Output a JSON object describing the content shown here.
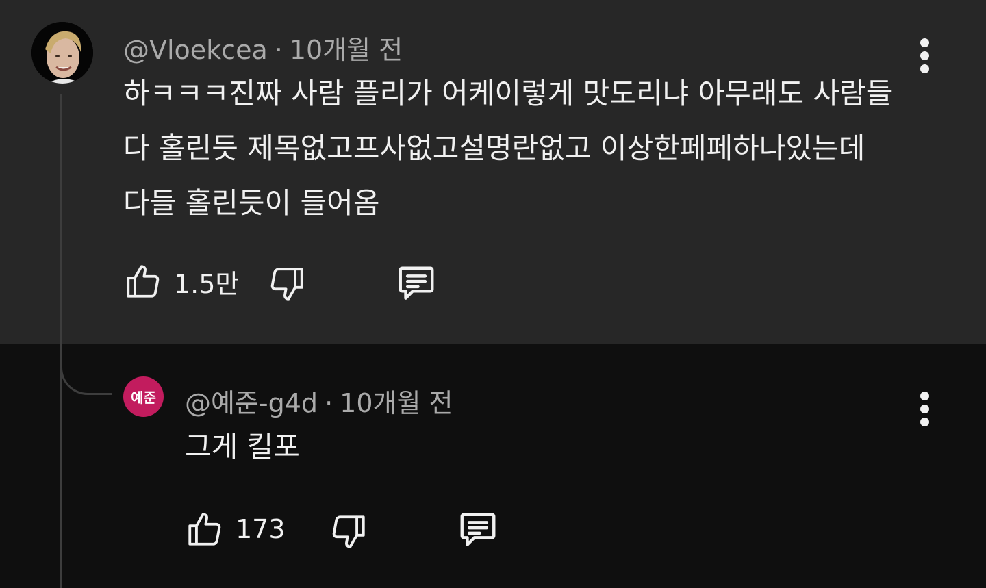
{
  "comment": {
    "author": "@Vloekcea",
    "separator": "·",
    "time": "10개월 전",
    "lines": [
      "하ㅋㅋㅋ진짜 사람 플리가 어케이렇게 맛도리냐 아무래도 사람들",
      "다 홀린듯 제목없고프사없고설명란없고 이상한페페하나있는데",
      "다들 홀린듯이 들어옴"
    ],
    "likes": "1.5만"
  },
  "reply": {
    "avatar_text": "예준",
    "author": "@예준-g4d",
    "separator": "·",
    "time": "10개월 전",
    "text": "그게 킬포",
    "likes": "173"
  },
  "icons": {
    "like": "thumbs-up-icon",
    "dislike": "thumbs-down-icon",
    "reply": "reply-comment-icon",
    "menu": "more-vertical-icon"
  },
  "colors": {
    "top_bg": "#272727",
    "reply_bg": "#0f0f0f",
    "avatar_reply_bg": "#c21c5e",
    "meta": "#aaaaaa",
    "text": "#f1f1f1"
  }
}
